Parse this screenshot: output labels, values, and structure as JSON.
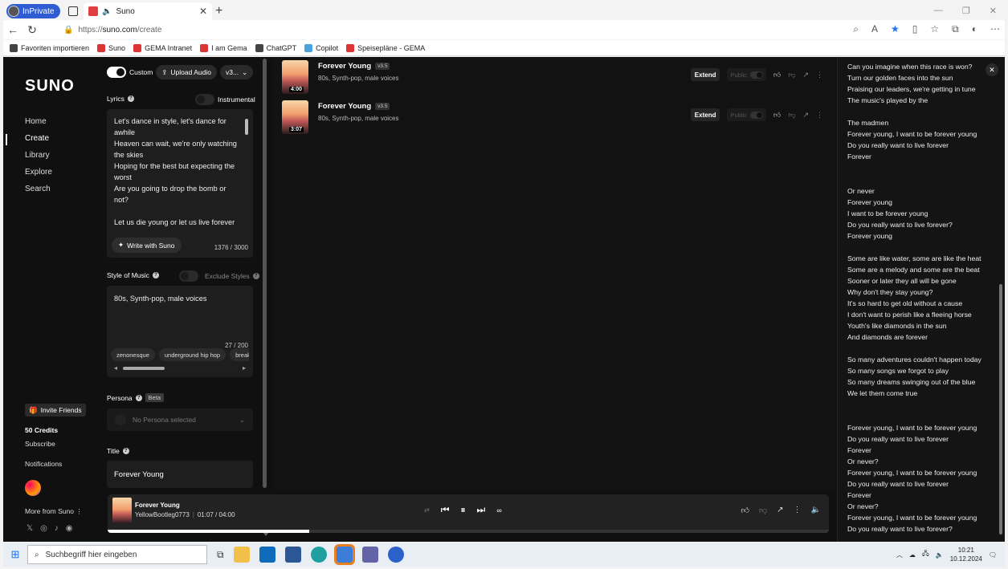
{
  "browser": {
    "inprivate_label": "InPrivate",
    "tab_title": "Suno",
    "url_prefix": "https://",
    "url_host": "suno.com",
    "url_path": "/create",
    "bookmarks": [
      "Favoriten importieren",
      "Suno",
      "GEMA Intranet",
      "I am Gema",
      "ChatGPT",
      "Copilot",
      "Speisepläne - GEMA"
    ]
  },
  "leftnav": {
    "logo": "SUNO",
    "items": [
      {
        "label": "Home"
      },
      {
        "label": "Create"
      },
      {
        "label": "Library"
      },
      {
        "label": "Explore"
      },
      {
        "label": "Search"
      }
    ],
    "invite": "Invite Friends",
    "credits": "50 Credits",
    "subscribe": "Subscribe",
    "notifications": "Notifications",
    "more_from": "More from Suno"
  },
  "create": {
    "custom_label": "Custom",
    "upload_label": "Upload Audio",
    "version_label": "v3...",
    "lyrics_label": "Lyrics",
    "instrumental_label": "Instrumental",
    "lyrics_text": "Let's dance in style, let's dance for awhile\nHeaven can wait, we're only watching the skies\nHoping for the best but expecting the worst\nAre you going to drop the bomb or not?\n\nLet us die young or let us live forever",
    "write_button": "Write with Suno",
    "lyrics_count": "1376 / 3000",
    "style_label": "Style of Music",
    "exclude_label": "Exclude Styles",
    "style_value": "80s, Synth-pop, male voices",
    "style_count": "27 / 200",
    "chips": [
      "zenonesque",
      "underground hip hop",
      "breakcore"
    ],
    "persona_label": "Persona",
    "beta_label": "Beta",
    "persona_value": "No Persona selected",
    "title_label": "Title",
    "title_value": "Forever Young"
  },
  "songs": [
    {
      "title": "Forever Young",
      "version": "v3.5",
      "style": "80s, Synth-pop, male voices",
      "duration": "4:00",
      "extend": "Extend",
      "public": "Public"
    },
    {
      "title": "Forever Young",
      "version": "v3.5",
      "style": "80s, Synth-pop, male voices",
      "duration": "3:07",
      "extend": "Extend",
      "public": "Public"
    }
  ],
  "lyrics_panel": {
    "text": "Can you imagine when this race is won?\nTurn our golden faces into the sun\nPraising our leaders, we're getting in tune\nThe music's played by the\n\nThe madmen\nForever young, I want to be forever young\nDo you really want to live forever\nForever\n\n\nOr never\nForever young\nI want to be forever young\nDo you really want to live forever?\nForever young\n\nSome are like water, some are like the heat\nSome are a melody and some are the beat\nSooner or later they all will be gone\nWhy don't they stay young?\nIt's so hard to get old without a cause\nI don't want to perish like a fleeing horse\nYouth's like diamonds in the sun\nAnd diamonds are forever\n\nSo many adventures couldn't happen today\nSo many songs we forgot to play\nSo many dreams swinging out of the blue\nWe let them come true\n\n\nForever young, I want to be forever young\nDo you really want to live forever\nForever\nOr never?\nForever young, I want to be forever young\nDo you really want to live forever\nForever\nOr never?\nForever young, I want to be forever young\nDo you really want to live forever?"
  },
  "player": {
    "title": "Forever Young",
    "artist": "YellowBootleg0773",
    "time": "01:07 / 04:00",
    "progress": 0.28
  },
  "taskbar": {
    "search_placeholder": "Suchbegriff hier eingeben",
    "time": "10:21",
    "date": "10.12.2024"
  }
}
